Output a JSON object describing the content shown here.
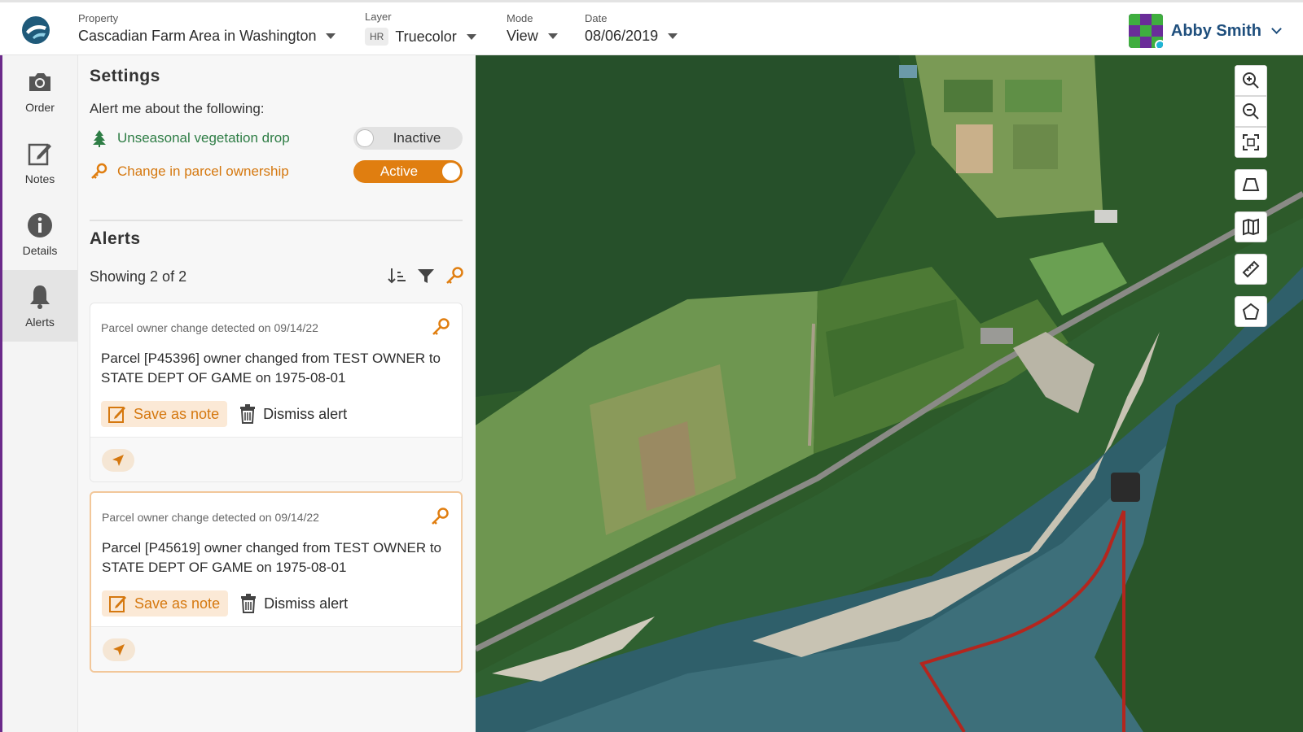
{
  "topbar": {
    "property_label": "Property",
    "property_value": "Cascadian Farm Area in Washington",
    "layer_label": "Layer",
    "layer_badge": "HR",
    "layer_value": "Truecolor",
    "mode_label": "Mode",
    "mode_value": "View",
    "date_label": "Date",
    "date_value": "08/06/2019",
    "user_name": "Abby Smith"
  },
  "rail": {
    "items": [
      {
        "label": "Order",
        "icon": "camera-icon"
      },
      {
        "label": "Notes",
        "icon": "notes-icon"
      },
      {
        "label": "Details",
        "icon": "info-icon"
      },
      {
        "label": "Alerts",
        "icon": "bell-icon",
        "active": true
      }
    ]
  },
  "settings": {
    "title": "Settings",
    "subtitle": "Alert me about the following:",
    "items": [
      {
        "label": "Unseasonal vegetation drop",
        "icon": "tree-icon",
        "state": "Inactive",
        "color": "#2e7d45"
      },
      {
        "label": "Change in parcel ownership",
        "icon": "key-icon",
        "state": "Active",
        "color": "#d5780f"
      }
    ]
  },
  "alerts": {
    "title": "Alerts",
    "showing": "Showing 2 of 2",
    "cards": [
      {
        "meta": "Parcel owner change detected on 09/14/22",
        "text": "Parcel [P45396] owner changed from TEST OWNER to STATE DEPT OF GAME on 1975-08-01",
        "save_label": "Save as note",
        "dismiss_label": "Dismiss alert"
      },
      {
        "meta": "Parcel owner change detected on 09/14/22",
        "text": "Parcel [P45619] owner changed from TEST OWNER to STATE DEPT OF GAME on 1975-08-01",
        "save_label": "Save as note",
        "dismiss_label": "Dismiss alert"
      }
    ]
  },
  "colors": {
    "accent": "#e07e10",
    "green": "#2e7d45",
    "brand_blue": "#1f4f7d",
    "boundary_red": "#b3261e"
  },
  "map_tools": [
    "zoom-in-icon",
    "zoom-out-icon",
    "fit-extent-icon",
    "perspective-icon",
    "map-book-icon",
    "ruler-icon",
    "polygon-icon"
  ]
}
